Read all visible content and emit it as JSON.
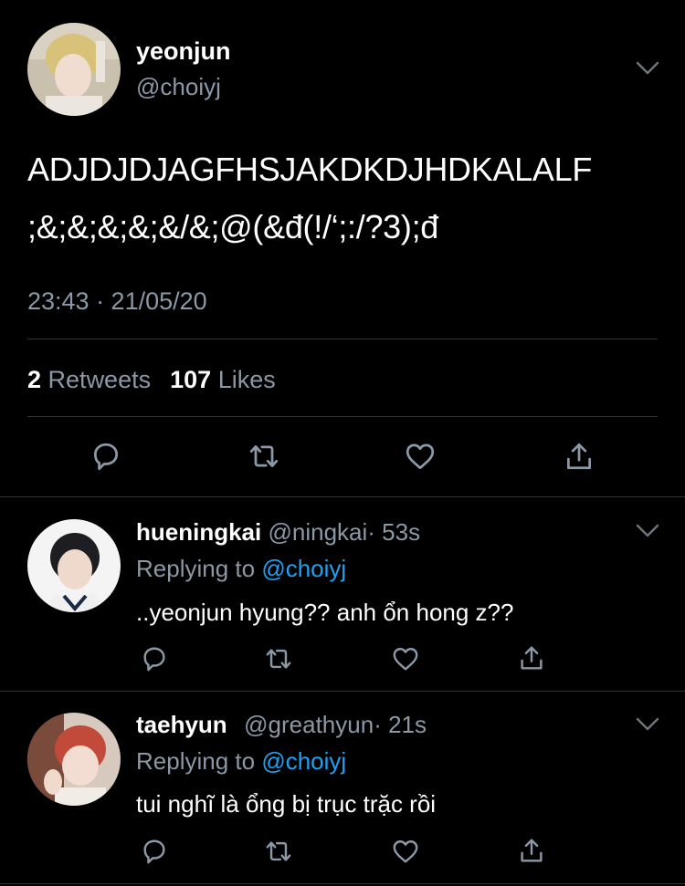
{
  "main_tweet": {
    "author_name": "yeonjun",
    "handle": "@choiyj",
    "text_line1": "ADJDJDJAGFHSJAKDKDJHDKALALF",
    "text_line2": ";&;&;&;&;&/&;@(&đ(!/‘;:/?3);đ",
    "timestamp": "23:43 · 21/05/20",
    "retweets_count": "2",
    "retweets_label": "Retweets",
    "likes_count": "107",
    "likes_label": "Likes"
  },
  "replies": [
    {
      "name": "hueningkai",
      "handle": "@ningkai",
      "time": "· 53s",
      "replying_prefix": "Replying to",
      "replying_to": "@choiyj",
      "text": "..yeonjun hyung?? anh ổn hong z??"
    },
    {
      "name": "taehyun",
      "handle": "@greathyun",
      "time": "· 21s",
      "replying_prefix": "Replying to",
      "replying_to": "@choiyj",
      "text": "tui nghĩ là ổng bị trục trặc rồi"
    }
  ],
  "icons": [
    "reply-icon",
    "retweet-icon",
    "like-icon",
    "share-icon",
    "chevron-down-icon"
  ],
  "colors": {
    "background": "#000000",
    "text": "#ffffff",
    "muted": "#8b98a5",
    "link": "#1da1f2",
    "divider": "#2f3336"
  }
}
